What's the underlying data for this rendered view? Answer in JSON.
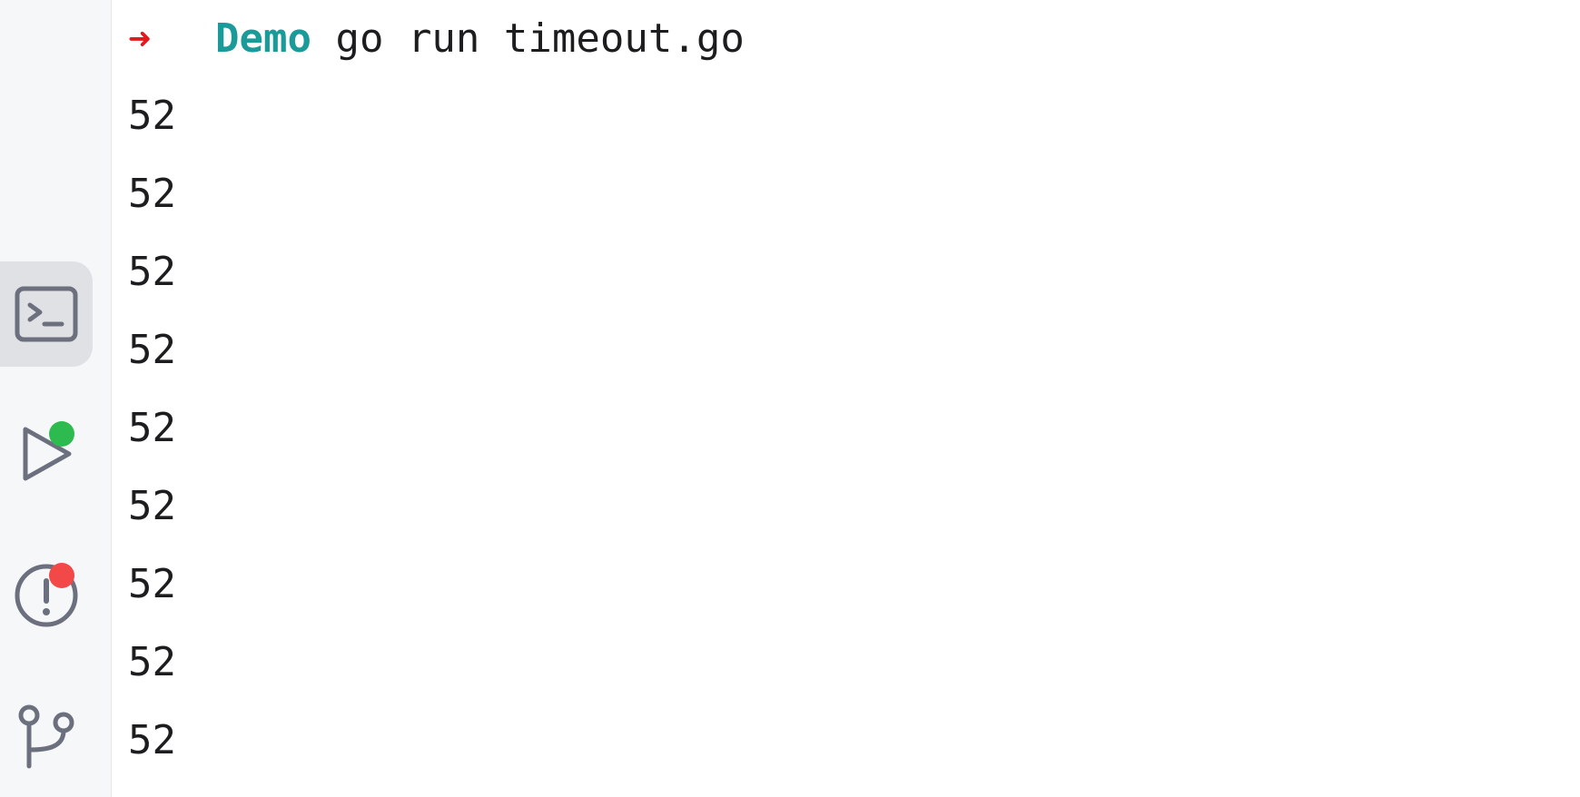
{
  "sidebar": {
    "tools": [
      {
        "name": "terminal",
        "icon": "terminal-icon",
        "active": true
      },
      {
        "name": "run",
        "icon": "run-icon",
        "badge_color": "#2dbb4f"
      },
      {
        "name": "problems",
        "icon": "problems-icon",
        "badge_color": "#f24848"
      },
      {
        "name": "git",
        "icon": "git-branch-icon"
      }
    ]
  },
  "terminal": {
    "prompt_symbol": "➜",
    "prompt_dir": "Demo",
    "command": "go run timeout.go",
    "output_lines": [
      "52",
      "52",
      "52",
      "52",
      "52",
      "52",
      "52",
      "52",
      "52"
    ]
  },
  "colors": {
    "prompt_arrow": "#e01b1b",
    "prompt_dir": "#1a9a98",
    "sidebar_bg": "#f6f7f9",
    "active_tool_bg": "#dfe1e5",
    "icon_stroke": "#6c707e"
  }
}
